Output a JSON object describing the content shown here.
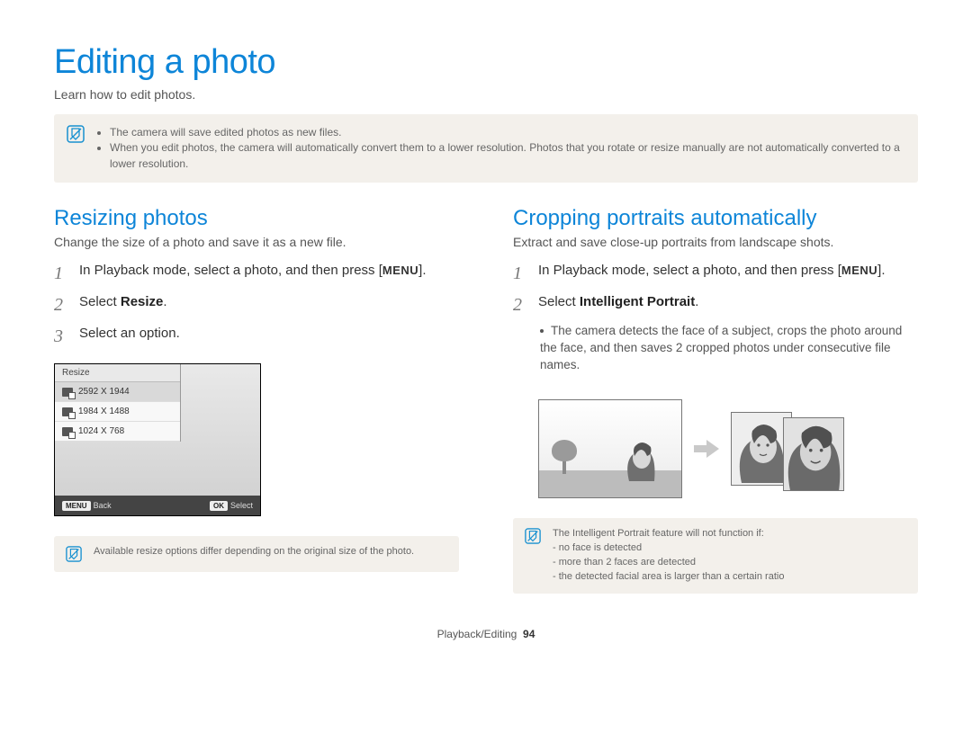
{
  "title": "Editing a photo",
  "subtitle": "Learn how to edit photos.",
  "top_notes": [
    "The camera will save edited photos as new files.",
    "When you edit photos, the camera will automatically convert them to a lower resolution. Photos that you rotate or resize manually are not automatically converted to a lower resolution."
  ],
  "left": {
    "heading": "Resizing photos",
    "desc": "Change the size of a photo and save it as a new file.",
    "steps": {
      "s1_pre": "In Playback mode, select a photo, and then press [",
      "s1_menu": "MENU",
      "s1_post": "].",
      "s2_pre": "Select ",
      "s2_bold": "Resize",
      "s2_post": ".",
      "s3": "Select an option."
    },
    "menu": {
      "title": "Resize",
      "items": [
        "2592 X 1944",
        "1984 X 1488",
        "1024 X 768"
      ],
      "back_btn": "MENU",
      "back_label": "Back",
      "select_btn": "OK",
      "select_label": "Select"
    },
    "note": "Available resize options differ depending on the original size of the photo."
  },
  "right": {
    "heading": "Cropping portraits automatically",
    "desc": "Extract and save close-up portraits from landscape shots.",
    "steps": {
      "s1_pre": "In Playback mode, select a photo, and then press [",
      "s1_menu": "MENU",
      "s1_post": "].",
      "s2_pre": "Select ",
      "s2_bold": "Intelligent Portrait",
      "s2_post": "."
    },
    "bullet": "The camera detects the face of a subject, crops the photo around the face, and then saves 2 cropped photos under consecutive file names.",
    "note_intro": "The Intelligent Portrait feature will not function if:",
    "note_items": [
      "no face is detected",
      "more than 2 faces are detected",
      "the detected facial area is larger than a certain ratio"
    ]
  },
  "footer": {
    "section": "Playback/Editing",
    "page": "94"
  }
}
